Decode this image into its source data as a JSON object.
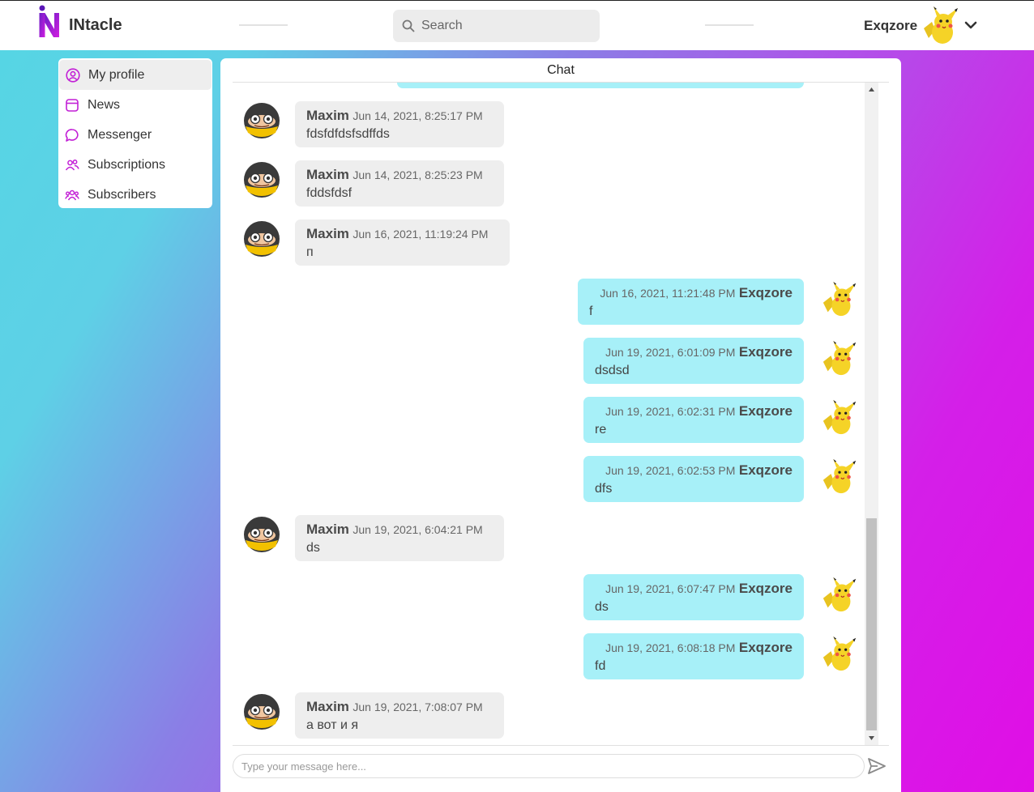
{
  "header": {
    "app_name": "INtacle",
    "search_placeholder": "Search",
    "user_name": "Exqzore"
  },
  "sidebar": {
    "items": [
      {
        "label": "My profile",
        "icon": "user-circle-icon",
        "active": true
      },
      {
        "label": "News",
        "icon": "news-icon",
        "active": false
      },
      {
        "label": "Messenger",
        "icon": "chat-bubble-icon",
        "active": false
      },
      {
        "label": "Subscriptions",
        "icon": "users-icon",
        "active": false
      },
      {
        "label": "Subscribers",
        "icon": "group-icon",
        "active": false
      }
    ]
  },
  "chat": {
    "title": "Chat",
    "composer_placeholder": "Type your message here...",
    "messages": [
      {
        "direction": "in",
        "author": "Maxim",
        "time": "Jun 14, 2021, 8:25:17 PM",
        "text": "fdsfdfdsfsdffds"
      },
      {
        "direction": "in",
        "author": "Maxim",
        "time": "Jun 14, 2021, 8:25:23 PM",
        "text": "fddsfdsf"
      },
      {
        "direction": "in",
        "author": "Maxim",
        "time": "Jun 16, 2021, 11:19:24 PM",
        "text": "п"
      },
      {
        "direction": "out",
        "author": "Exqzore",
        "time": "Jun 16, 2021, 11:21:48 PM",
        "text": "f"
      },
      {
        "direction": "out",
        "author": "Exqzore",
        "time": "Jun 19, 2021, 6:01:09 PM",
        "text": "dsdsd"
      },
      {
        "direction": "out",
        "author": "Exqzore",
        "time": "Jun 19, 2021, 6:02:31 PM",
        "text": "re"
      },
      {
        "direction": "out",
        "author": "Exqzore",
        "time": "Jun 19, 2021, 6:02:53 PM",
        "text": "dfs"
      },
      {
        "direction": "in",
        "author": "Maxim",
        "time": "Jun 19, 2021, 6:04:21 PM",
        "text": "ds"
      },
      {
        "direction": "out",
        "author": "Exqzore",
        "time": "Jun 19, 2021, 6:07:47 PM",
        "text": "ds"
      },
      {
        "direction": "out",
        "author": "Exqzore",
        "time": "Jun 19, 2021, 6:08:18 PM",
        "text": "fd"
      },
      {
        "direction": "in",
        "author": "Maxim",
        "time": "Jun 19, 2021, 7:08:07 PM",
        "text": "а вот и я"
      }
    ]
  },
  "colors": {
    "accent": "#c21fd6",
    "incoming_bubble": "#eeeeee",
    "outgoing_bubble": "#a7f0f8"
  }
}
